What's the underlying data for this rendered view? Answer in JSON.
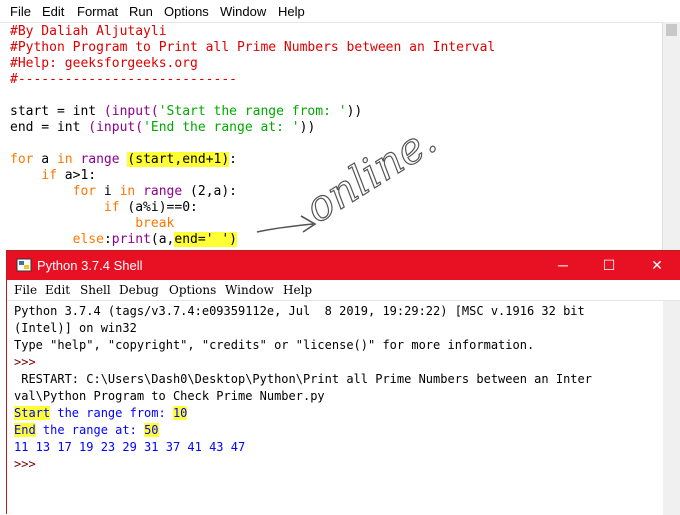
{
  "editor": {
    "menu": [
      "File",
      "Edit",
      "Format",
      "Run",
      "Options",
      "Window",
      "Help"
    ],
    "comment_lines": [
      "#By Daliah Aljutayli",
      "#Python Program to Print all Prime Numbers between an Interval",
      "#Help: geeksforgeeks.org",
      "#----------------------------"
    ],
    "code": {
      "start_var": "start = int",
      "start_input": "(input(",
      "start_prompt": "'Start the range from: '",
      "start_close": "))",
      "end_var": "end = int",
      "end_input": "(input(",
      "end_prompt": "'End the range at: '",
      "end_close": "))",
      "for1_kw": "for",
      "for1_mid": " a ",
      "for1_in": "in",
      "for1_range": " range ",
      "for1_args": "(start,end+1)",
      "for1_colon": ":",
      "if1_kw": "if",
      "if1_rest": " a>1:",
      "for2_kw": "for",
      "for2_mid": " i ",
      "for2_in": "in",
      "for2_range": " range ",
      "for2_args": "(2,a):",
      "if2_kw": "if",
      "if2_rest": " (a%i)==0:",
      "break_kw": "break",
      "else_kw": "else",
      "else_colon": ":",
      "print_fn": "print",
      "print_args": "(a,",
      "print_end": "end=' ')"
    },
    "annotation_text": "online."
  },
  "shell": {
    "title": "Python 3.7.4 Shell",
    "controls": {
      "minimize": "─",
      "maximize": "☐",
      "close": "✕"
    },
    "menu": [
      "File",
      "Edit",
      "Shell",
      "Debug",
      "Options",
      "Window",
      "Help"
    ],
    "banner_line1": "Python 3.7.4 (tags/v3.7.4:e09359112e, Jul  8 2019, 19:29:22) [MSC v.1916 32 bit",
    "banner_line2": "(Intel)] on win32",
    "banner_line3": "Type \"help\", \"copyright\", \"credits\" or \"license()\" for more information.",
    "prompt": ">>>",
    "restart_line1": " RESTART: C:\\Users\\Dash0\\Desktop\\Python\\Print all Prime Numbers between an Inter",
    "restart_line2": "val\\Python Program to Check Prime Number.py",
    "start_label_a": "Start",
    "start_label_b": " the range from: ",
    "start_value": "10",
    "end_label_a": "End",
    "end_label_b": " the range at: ",
    "end_value": "50",
    "output": "11 13 17 19 23 29 31 37 41 43 47",
    "prompt2": ">>>"
  }
}
